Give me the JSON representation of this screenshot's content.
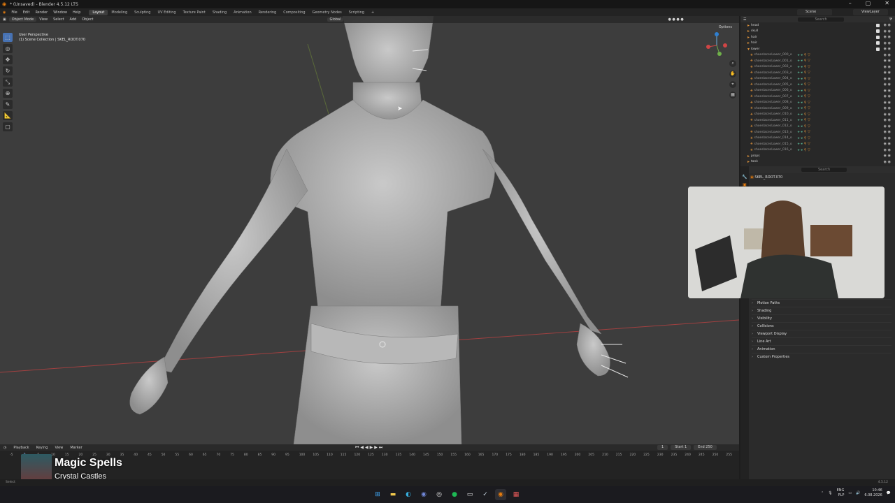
{
  "window": {
    "title": "* (Unsaved) - Blender 4.5.12 LTS"
  },
  "menus": [
    "File",
    "Edit",
    "Render",
    "Window",
    "Help"
  ],
  "workspaces": [
    {
      "label": "Layout",
      "active": true
    },
    {
      "label": "Modeling"
    },
    {
      "label": "Sculpting"
    },
    {
      "label": "UV Editing"
    },
    {
      "label": "Texture Paint"
    },
    {
      "label": "Shading"
    },
    {
      "label": "Animation"
    },
    {
      "label": "Rendering"
    },
    {
      "label": "Compositing"
    },
    {
      "label": "Geometry Nodes"
    },
    {
      "label": "Scripting"
    }
  ],
  "scene": "Scene",
  "view_layer": "ViewLayer",
  "viewport": {
    "mode": "Object Mode",
    "menus": [
      "View",
      "Select",
      "Add",
      "Object"
    ],
    "transform": "Global",
    "options": "Options",
    "info_line1": "User Perspective",
    "info_line2": "(1) Scene Collection | SKEL_ROOT.070"
  },
  "outliner": {
    "search_placeholder": "Search",
    "collections": [
      {
        "label": "head"
      },
      {
        "label": "skull"
      },
      {
        "label": "hair"
      },
      {
        "label": "hair"
      },
      {
        "label": "lower"
      }
    ],
    "objects": [
      "shoeslacesLower_000_o",
      "shoeslacesLower_001_o",
      "shoeslacesLower_002_o",
      "shoeslacesLower_003_o",
      "shoeslacesLower_004_o",
      "shoeslacesLower_005_o",
      "shoeslacesLower_006_o",
      "shoeslacesLower_007_o",
      "shoeslacesLower_008_o",
      "shoeslacesLower_009_o",
      "shoeslacesLower_010_o",
      "shoeslacesLower_011_o",
      "shoeslacesLower_012_o",
      "shoeslacesLower_013_o",
      "shoeslacesLower_014_o",
      "shoeslacesLower_015_o",
      "shoeslacesLower_016_o"
    ],
    "footer": [
      "props",
      "tank"
    ]
  },
  "properties": {
    "search_placeholder": "Search",
    "object_name": "SKEL_ROOT.070",
    "panels": [
      "Motion Paths",
      "Shading",
      "Visibility",
      "Collisions",
      "Viewport Display",
      "Line Art",
      "Animation",
      "Custom Properties"
    ]
  },
  "timeline": {
    "menus": [
      "Playback",
      "Keying",
      "View",
      "Marker"
    ],
    "current_frame": "1",
    "start_label": "Start",
    "start": "1",
    "end_label": "End",
    "end": "250",
    "ticks": [
      "-5",
      "0",
      "5",
      "10",
      "15",
      "20",
      "25",
      "30",
      "35",
      "40",
      "45",
      "50",
      "55",
      "60",
      "65",
      "70",
      "75",
      "80",
      "85",
      "90",
      "95",
      "100",
      "105",
      "110",
      "115",
      "120",
      "125",
      "130",
      "135",
      "140",
      "145",
      "150",
      "155",
      "160",
      "165",
      "170",
      "175",
      "180",
      "185",
      "190",
      "195",
      "200",
      "205",
      "210",
      "215",
      "220",
      "225",
      "230",
      "235",
      "240",
      "245",
      "250",
      "255"
    ]
  },
  "now_playing": {
    "title": "Magic Spells",
    "artist": "Crystal Castles"
  },
  "status": {
    "version": "4.5.12",
    "left": "Select"
  },
  "tray": {
    "lang1": "ENG",
    "lang2": "PLP",
    "time": "10:46",
    "date": "6.08.2026"
  }
}
